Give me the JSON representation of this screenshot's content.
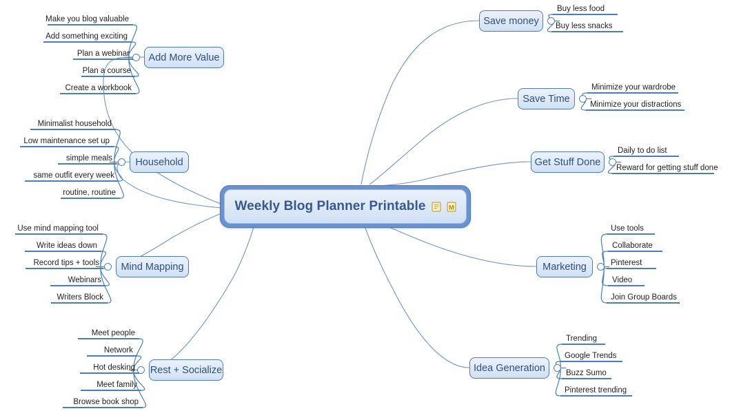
{
  "document": {
    "type": "mind-map",
    "background_color": "#ffffff",
    "accent_color": "#4f79b8",
    "node_fill_color": "#dfeaf8",
    "node_text_color": "#2f4f7f",
    "leaf_underline_color": "#4a7ebb",
    "central_border_color": "#6a92cf",
    "central_text_color": "#36588f"
  },
  "central": {
    "title": "Weekly Blog Planner Printable",
    "icons": [
      {
        "name": "note-icon",
        "label": "note"
      },
      {
        "name": "letter-m-icon",
        "label": "M"
      }
    ]
  },
  "branches": [
    {
      "id": "add-more-value",
      "label": "Add More Value",
      "side": "left",
      "children": [
        "Make you blog valuable",
        "Add something exciting",
        "Plan a webinar",
        "Plan a course",
        "Create a workbook"
      ]
    },
    {
      "id": "household",
      "label": "Household",
      "side": "left",
      "children": [
        "Minimalist household",
        "Low maintenance set up",
        "simple meals",
        "same outfit every week",
        "routine, routine"
      ]
    },
    {
      "id": "mind-mapping",
      "label": "Mind Mapping",
      "side": "left",
      "children": [
        "Use mind mapping tool",
        "Write ideas down",
        "Record tips + tools",
        "Webinars",
        "Writers Block"
      ]
    },
    {
      "id": "rest-socialize",
      "label": "Rest + Socialize",
      "side": "left",
      "children": [
        "Meet people",
        "Network",
        "Hot desking",
        "Meet family",
        "Browse book shop"
      ]
    },
    {
      "id": "save-money",
      "label": "Save money",
      "side": "right",
      "children": [
        "Buy less food",
        "Buy less snacks"
      ]
    },
    {
      "id": "save-time",
      "label": "Save Time",
      "side": "right",
      "children": [
        "Minimize your wardrobe",
        "Minimize your distractions"
      ]
    },
    {
      "id": "get-stuff-done",
      "label": "Get Stuff Done",
      "side": "right",
      "children": [
        "Daily to do list",
        "Reward for getting stuff done"
      ]
    },
    {
      "id": "marketing",
      "label": "Marketing",
      "side": "right",
      "children": [
        "Use tools",
        "Collaborate",
        "Pinterest",
        "Video",
        "Join Group Boards"
      ]
    },
    {
      "id": "idea-generation",
      "label": "Idea Generation",
      "side": "right",
      "children": [
        "Trending",
        "Google Trends",
        "Buzz Sumo",
        "Pinterest trending"
      ]
    }
  ]
}
